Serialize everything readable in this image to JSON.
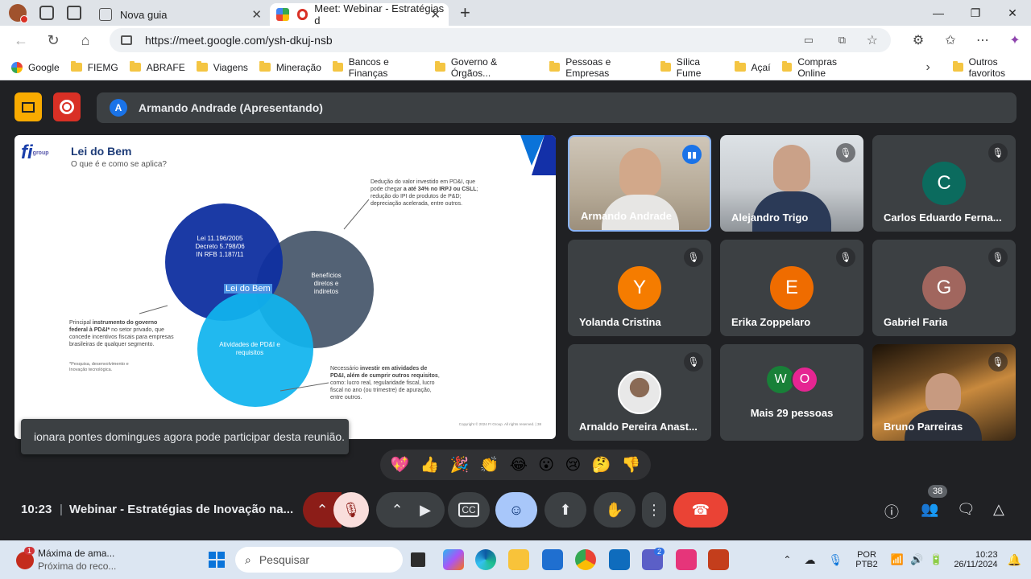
{
  "browser": {
    "tabs": [
      {
        "title": "Nova guia"
      },
      {
        "title": "Meet: Webinar - Estratégias d"
      }
    ],
    "url": "https://meet.google.com/ysh-dkuj-nsb",
    "bookmarks": [
      "Google",
      "FIEMG",
      "ABRAFE",
      "Viagens",
      "Mineração",
      "Bancos e Finanças",
      "Governo & Órgãos...",
      "Pessoas e Empresas",
      "Sílica Fume",
      "Açaí",
      "Compras Online"
    ],
    "other_bookmarks": "Outros favoritos"
  },
  "meet": {
    "presenter_initial": "A",
    "presenter_label": "Armando Andrade (Apresentando)",
    "slide": {
      "logo_text": "fi",
      "logo_sub": "group",
      "title": "Lei do Bem",
      "subtitle": "O que é e como se aplica?",
      "circle_dark": "Lei 11.196/2005\nDecreto 5.798/06\nIN RFB 1.187/11",
      "circle_center": "Lei do Bem",
      "circle_grey": "Benefícios diretos e indiretos",
      "circle_light": "Atividades de PD&I e requisitos",
      "note_top_1": "Dedução do valor investido em PD&I, que pode chegar ",
      "note_top_bold": "a até 34% no IRPJ ou CSLL",
      "note_top_2": "; redução do IPI de produtos de P&D; depreciação acelerada, entre outros.",
      "note_left_1": "Principal ",
      "note_left_bold": "instrumento do governo federal à PD&I*",
      "note_left_2": " no setor privado, que concede incentivos fiscais para empresas brasileiras de qualquer segmento.",
      "note_left_foot": "*Pesquisa, desenvolvimento e Inovação tecnológica.",
      "note_bottom_1": "Necessário ",
      "note_bottom_bold": "investir em atividades de PD&I, além de cumprir outros requisitos",
      "note_bottom_2": ", como: lucro real, regularidade fiscal, lucro fiscal no ano (ou trimestre) de apuração, entre outros.",
      "footer": "Copyright © 2024 FI Group. All rights reserved.  |  38"
    },
    "participants": [
      {
        "name": "Armando Andrade"
      },
      {
        "name": "Alejandro Trigo"
      },
      {
        "name": "Carlos Eduardo Ferna...",
        "initial": "C",
        "color": "#0b6b5e"
      },
      {
        "name": "Yolanda Cristina",
        "initial": "Y",
        "color": "#f57c00"
      },
      {
        "name": "Erika Zoppelaro",
        "initial": "E",
        "color": "#ef6c00"
      },
      {
        "name": "Gabriel Faria",
        "initial": "G",
        "color": "#a1665e"
      },
      {
        "name": "Arnaldo Pereira Anast..."
      },
      {
        "name": "Mais 29 pessoas",
        "initials": [
          "W",
          "O"
        ]
      },
      {
        "name": "Bruno Parreiras"
      }
    ],
    "toast": "ionara pontes domingues agora pode participar desta reunião.",
    "reactions": [
      "💖",
      "👍",
      "🎉",
      "👏",
      "😂",
      "😮",
      "😢",
      "🤔",
      "👎"
    ],
    "time": "10:23",
    "meeting_title": "Webinar - Estratégias de Inovação na...",
    "people_count": "38"
  },
  "taskbar": {
    "notification_title": "Máxima de ama...",
    "notification_sub": "Próxima do reco...",
    "search_placeholder": "Pesquisar",
    "language": "POR",
    "layout": "PTB2",
    "clock_time": "10:23",
    "clock_date": "26/11/2024",
    "teams_badge": "2",
    "notif_badge": "1"
  },
  "colors": {
    "accent": "#1a73e8",
    "hangup": "#ea4335",
    "mic_off": "#f9dedc"
  }
}
